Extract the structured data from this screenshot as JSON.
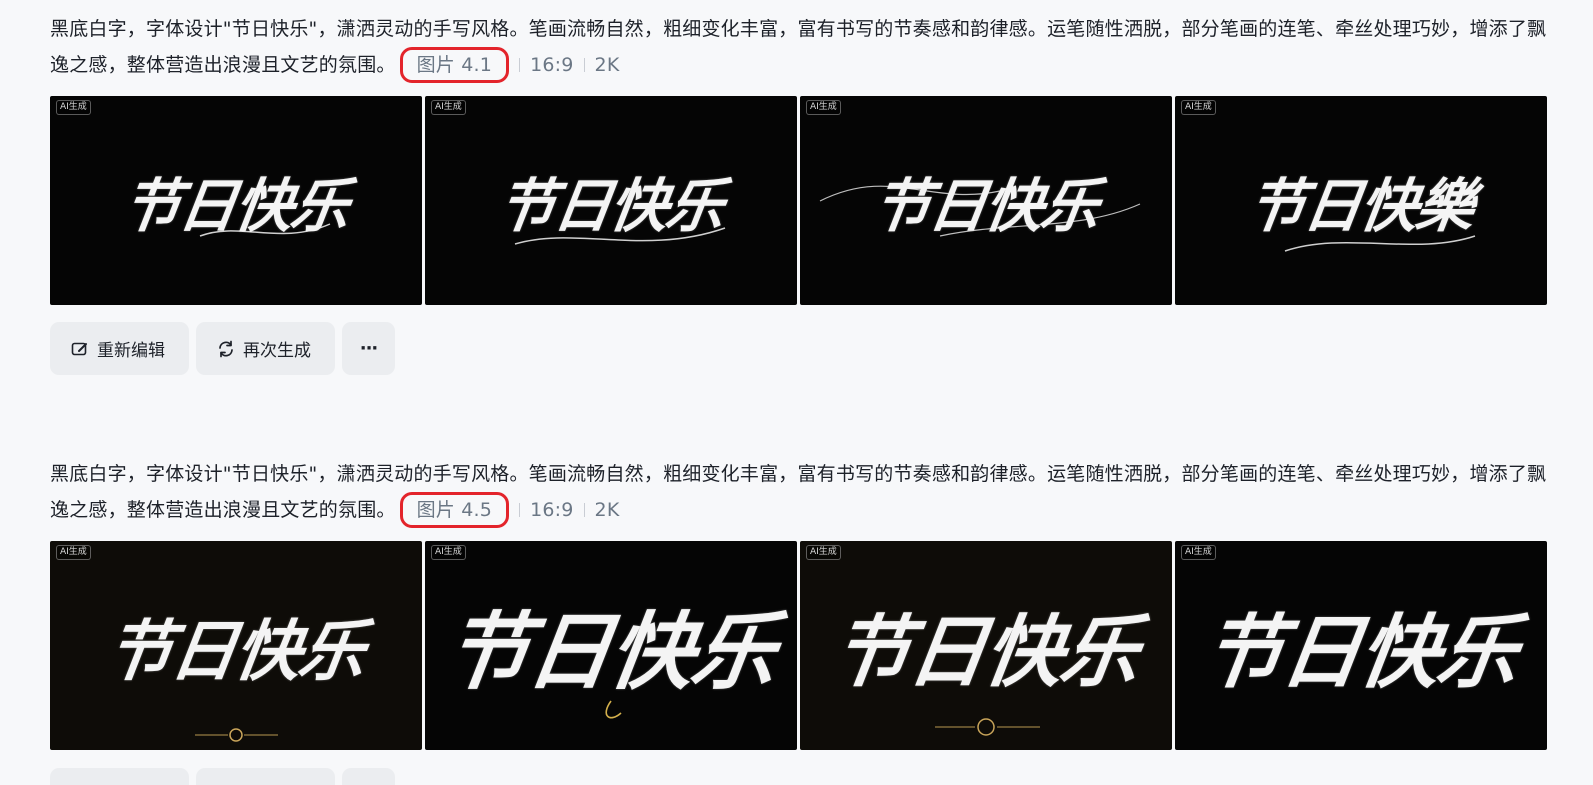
{
  "prompt_text": "黑底白字，字体设计\"节日快乐\"，潇洒灵动的手写风格。笔画流畅自然，粗细变化丰富，富有书写的节奏感和韵律感。运笔随性洒脱，部分笔画的连笔、牵丝处理巧妙，增添了飘逸之感，整体营造出浪漫且文艺的氛围。",
  "generations": [
    {
      "model_label": "图片 4.1",
      "ratio": "16:9",
      "resolution": "2K",
      "images": [
        {
          "badge": "AI生成",
          "text": "节日快乐"
        },
        {
          "badge": "AI生成",
          "text": "节日快乐"
        },
        {
          "badge": "AI生成",
          "text": "节日快乐"
        },
        {
          "badge": "AI生成",
          "text": "节日快樂"
        }
      ],
      "actions": {
        "edit_label": "重新编辑",
        "regenerate_label": "再次生成",
        "more_label": "···"
      }
    },
    {
      "model_label": "图片 4.5",
      "ratio": "16:9",
      "resolution": "2K",
      "images": [
        {
          "badge": "AI生成",
          "text": "节日快乐"
        },
        {
          "badge": "AI生成",
          "text": "节日快乐"
        },
        {
          "badge": "AI生成",
          "text": "节日快乐"
        },
        {
          "badge": "AI生成",
          "text": "节日快乐"
        }
      ]
    }
  ],
  "colors": {
    "highlight_border": "#e3242b",
    "page_background": "#f7f8fa",
    "button_background": "#ebedf0"
  }
}
